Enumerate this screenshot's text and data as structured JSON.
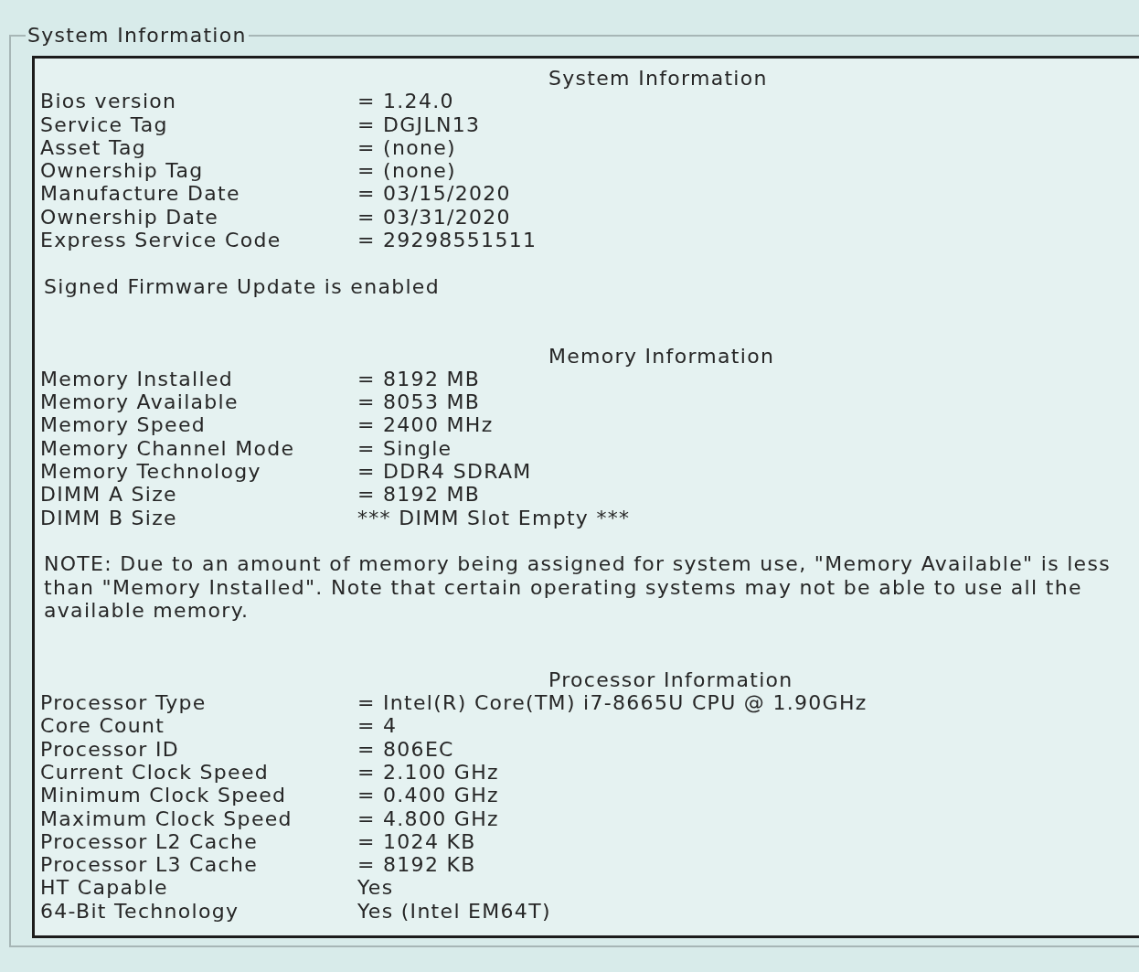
{
  "group_box": {
    "title": "System Information"
  },
  "sections": [
    {
      "title": "System Information",
      "rows": [
        {
          "label": "Bios version",
          "value": "= 1.24.0"
        },
        {
          "label": "Service Tag",
          "value": "= DGJLN13"
        },
        {
          "label": "Asset Tag",
          "value": "= (none)"
        },
        {
          "label": "Ownership Tag",
          "value": "= (none)"
        },
        {
          "label": "Manufacture Date",
          "value": "= 03/15/2020"
        },
        {
          "label": "Ownership Date",
          "value": "= 03/31/2020"
        },
        {
          "label": "Express Service Code",
          "value": "= 29298551511"
        }
      ],
      "notes": [
        "Signed Firmware Update is enabled"
      ]
    },
    {
      "title": "Memory Information",
      "rows": [
        {
          "label": "Memory Installed",
          "value": "= 8192 MB"
        },
        {
          "label": "Memory Available",
          "value": "= 8053 MB"
        },
        {
          "label": "Memory Speed",
          "value": "= 2400 MHz"
        },
        {
          "label": "Memory Channel Mode",
          "value": "= Single"
        },
        {
          "label": "Memory Technology",
          "value": "= DDR4 SDRAM"
        },
        {
          "label": "DIMM A Size",
          "value": "= 8192 MB"
        },
        {
          "label": "DIMM B Size",
          "value": "*** DIMM Slot Empty ***"
        }
      ],
      "notes": [
        "NOTE: Due to an amount of memory being assigned for system use, \"Memory Available\" is less than \"Memory Installed\". Note that certain operating systems may not be able to use all the available memory."
      ]
    },
    {
      "title": "Processor Information",
      "rows": [
        {
          "label": "Processor Type",
          "value": "= Intel(R) Core(TM) i7-8665U CPU @ 1.90GHz"
        },
        {
          "label": "Core Count",
          "value": "= 4"
        },
        {
          "label": "Processor ID",
          "value": "= 806EC"
        },
        {
          "label": "Current Clock Speed",
          "value": "= 2.100 GHz"
        },
        {
          "label": "Minimum Clock Speed",
          "value": "= 0.400 GHz"
        },
        {
          "label": "Maximum Clock Speed",
          "value": "= 4.800 GHz"
        },
        {
          "label": "Processor L2 Cache",
          "value": "= 1024 KB"
        },
        {
          "label": "Processor L3 Cache",
          "value": "= 8192 KB"
        },
        {
          "label": "HT Capable",
          "value": "Yes"
        },
        {
          "label": "64-Bit Technology",
          "value": "Yes (Intel EM64T)"
        }
      ]
    }
  ]
}
